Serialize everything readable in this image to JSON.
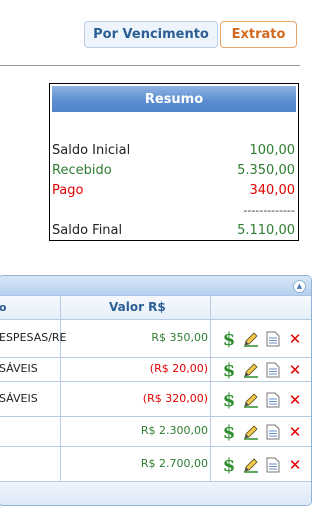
{
  "tabs": {
    "por_vencimento": "Por Vencimento",
    "extrato": "Extrato"
  },
  "resumo": {
    "title": "Resumo",
    "saldo_inicial_label": "Saldo Inicial",
    "saldo_inicial_value": "100,00",
    "recebido_label": "Recebido",
    "recebido_value": "5.350,00",
    "pago_label": "Pago",
    "pago_value": "340,00",
    "separator": "-------------",
    "saldo_final_label": "Saldo Final",
    "saldo_final_value": "5.110,00"
  },
  "grid": {
    "col_desc_header": "o",
    "col_valor_header": "Valor R$",
    "rows": [
      {
        "desc": "ESPESAS/RE",
        "valor": "R$ 350,00",
        "kind": "pos"
      },
      {
        "desc": "SÁVEIS",
        "valor": "(R$ 20,00)",
        "kind": "neg"
      },
      {
        "desc": "SÁVEIS",
        "valor": "(R$ 320,00)",
        "kind": "neg"
      },
      {
        "desc": "",
        "valor": "R$ 2.300,00",
        "kind": "pos"
      },
      {
        "desc": "",
        "valor": "R$ 2.700,00",
        "kind": "pos"
      }
    ]
  },
  "icons": {
    "pay": "dollar-icon",
    "edit": "pencil-icon",
    "view": "document-icon",
    "delete": "delete-x-icon",
    "collapse": "chevron-up-icon"
  },
  "colors": {
    "accent": "#2b5f95",
    "positive": "#2e7d32",
    "negative": "#e00000",
    "extrato": "#d2691e",
    "header_blue": "#5d8fd1"
  }
}
